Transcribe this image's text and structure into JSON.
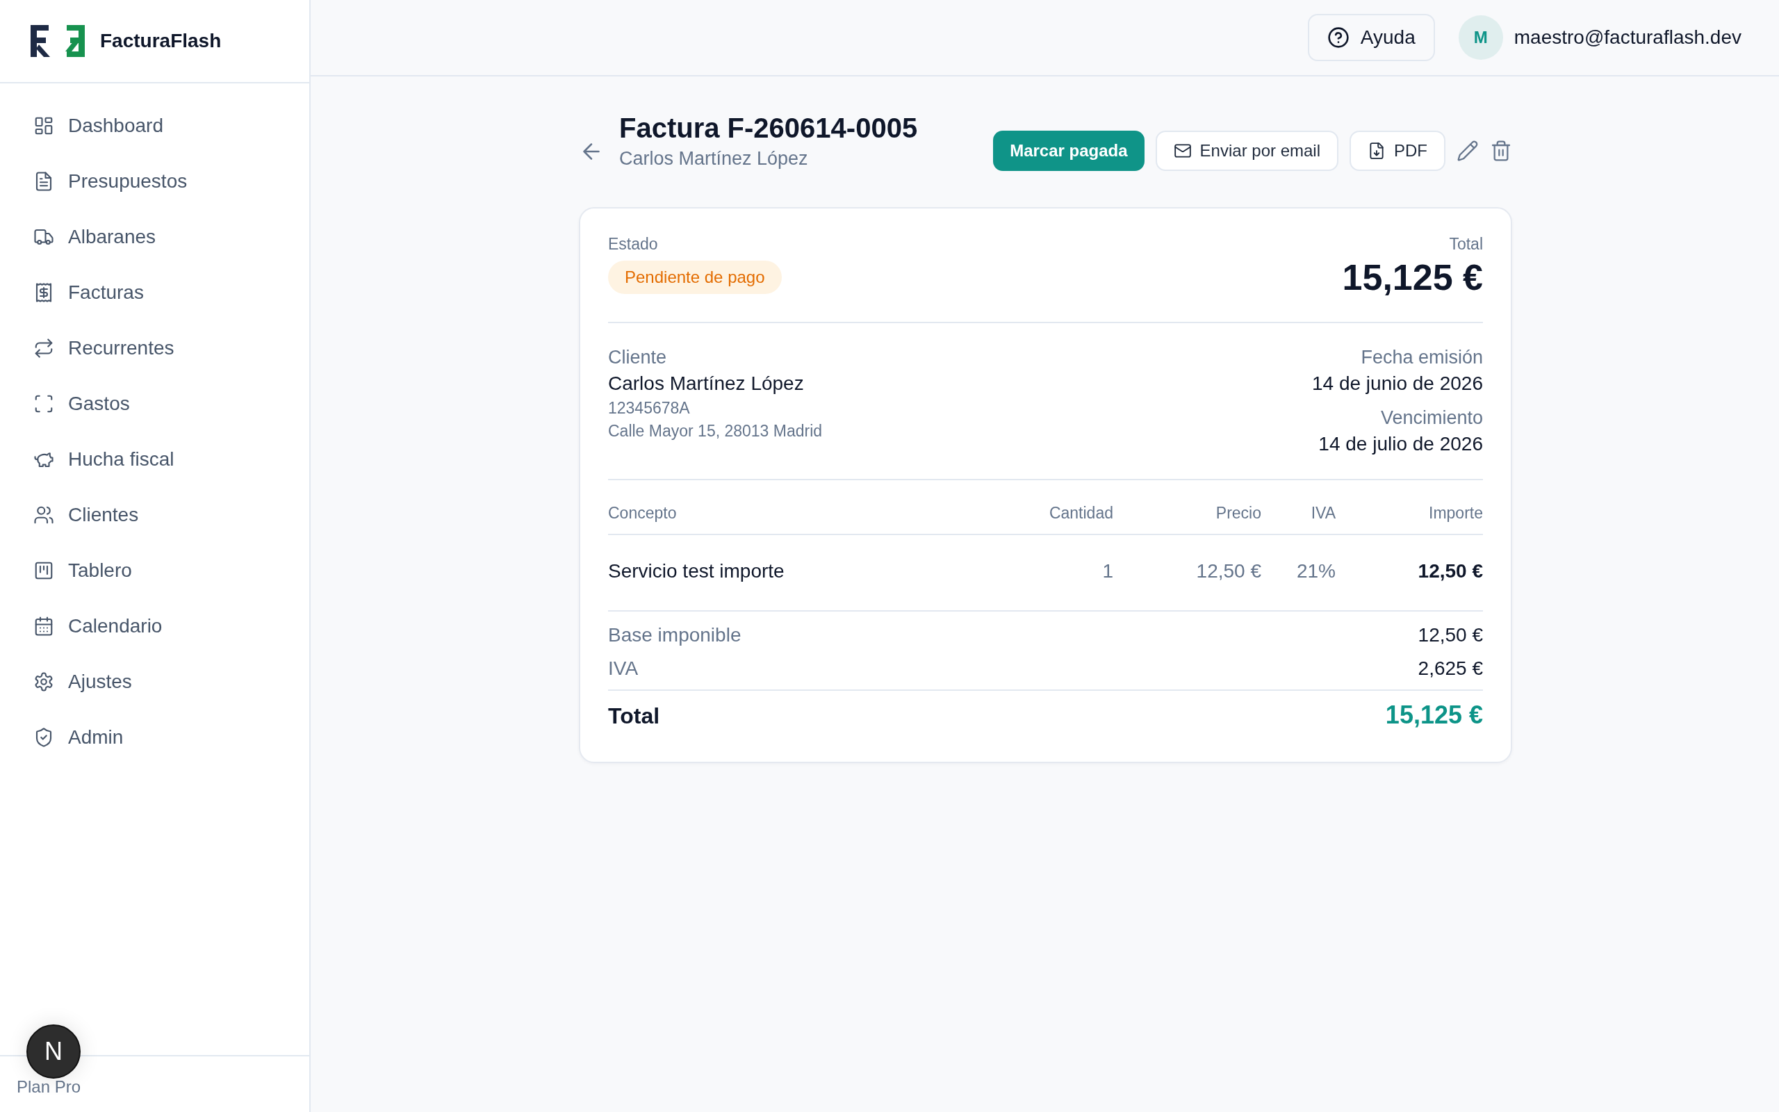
{
  "brand": {
    "name": "FacturaFlash"
  },
  "sidebar": {
    "items": [
      {
        "label": "Dashboard"
      },
      {
        "label": "Presupuestos"
      },
      {
        "label": "Albaranes"
      },
      {
        "label": "Facturas"
      },
      {
        "label": "Recurrentes"
      },
      {
        "label": "Gastos"
      },
      {
        "label": "Hucha fiscal"
      },
      {
        "label": "Clientes"
      },
      {
        "label": "Tablero"
      },
      {
        "label": "Calendario"
      },
      {
        "label": "Ajustes"
      },
      {
        "label": "Admin"
      }
    ],
    "plan": "Plan Pro"
  },
  "header": {
    "help_button": "Ayuda",
    "user": {
      "initial": "M",
      "email": "maestro@facturaflash.dev"
    }
  },
  "invoice": {
    "title": "Factura F-260614-0005",
    "client_name": "Carlos Martínez López",
    "actions": [
      {
        "kind": "primary",
        "label": "Marcar pagada"
      },
      {
        "kind": "outline",
        "label": "Enviar por email"
      },
      {
        "kind": "outline",
        "label": "PDF"
      }
    ]
  },
  "summary": {
    "status_label": "Estado",
    "status": "Pendiente de pago",
    "total_label": "Total",
    "total": "15,125 €"
  },
  "client": {
    "label": "Cliente",
    "name": "Carlos Martínez López",
    "tax_id": "12345678A",
    "address": "Calle Mayor 15, 28013 Madrid"
  },
  "dates": [
    {
      "label": "Fecha emisión",
      "value": "14 de junio de 2026"
    },
    {
      "label": "Vencimiento",
      "value": "14 de julio de 2026"
    }
  ],
  "table": {
    "columns": [
      "Concepto",
      "Cantidad",
      "Precio",
      "IVA",
      "Importe"
    ],
    "rows": [
      [
        "Servicio test importe",
        "1",
        "12,50 €",
        "21%",
        "12,50 €"
      ]
    ]
  },
  "totals": [
    {
      "label": "Base imponible",
      "value": "12,50 €"
    },
    {
      "label": "IVA",
      "value": "2,625 €"
    }
  ],
  "grand_total": {
    "label": "Total",
    "value": "15,125 €"
  },
  "dev_indicator": {
    "letter": "N"
  }
}
